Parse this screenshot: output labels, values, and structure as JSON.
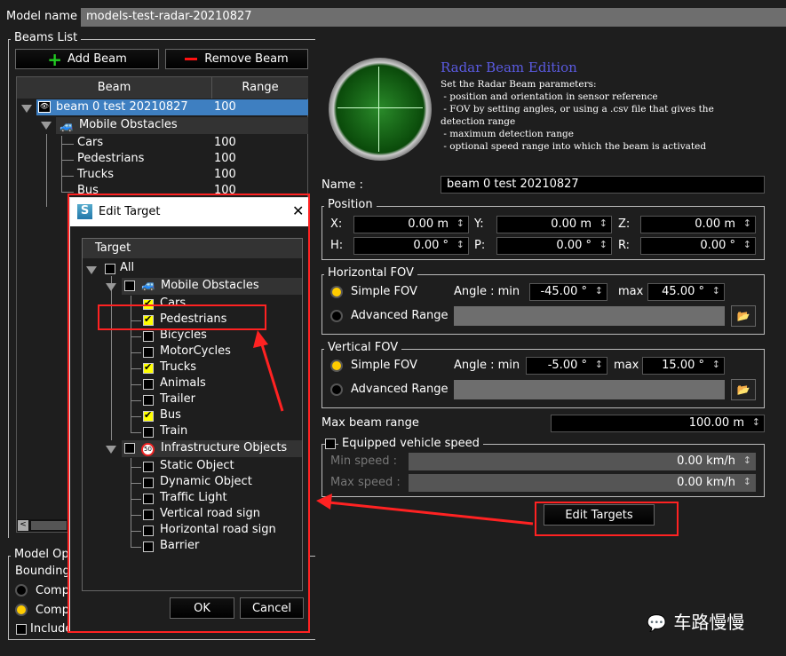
{
  "model_name": {
    "label": "Model name",
    "value": "models-test-radar-20210827"
  },
  "beams": {
    "title": "Beams List",
    "add": "Add Beam",
    "remove": "Remove Beam",
    "col_beam": "Beam",
    "col_range": "Range",
    "beam": {
      "name": "beam 0 test 20210827",
      "range": "100"
    },
    "group": "Mobile Obstacles",
    "items": [
      {
        "name": "Cars",
        "range": "100"
      },
      {
        "name": "Pedestrians",
        "range": "100"
      },
      {
        "name": "Trucks",
        "range": "100"
      },
      {
        "name": "Bus",
        "range": "100"
      }
    ]
  },
  "model_options": {
    "title": "Model Opt",
    "bounding": "Bounding",
    "opt1": "Comp",
    "opt2": "Comp",
    "include": "Include"
  },
  "info": {
    "title": "Radar Beam Edition",
    "lines": [
      "Set the Radar Beam parameters:",
      " - position and orientation in sensor reference",
      " - FOV by setting angles, or using a .csv file that gives the",
      "detection range",
      " - maximum detection range",
      " - optional speed range into which the beam is activated"
    ]
  },
  "name": {
    "label": "Name :",
    "value": "beam 0 test 20210827"
  },
  "position": {
    "title": "Position",
    "x": "0.00 m",
    "y": "0.00 m",
    "z": "0.00 m",
    "h": "0.00 °",
    "p": "0.00 °",
    "r": "0.00 °",
    "lx": "X:",
    "ly": "Y:",
    "lz": "Z:",
    "lh": "H:",
    "lp": "P:",
    "lr": "R:"
  },
  "hfov": {
    "title": "Horizontal FOV",
    "simple": "Simple FOV",
    "advanced": "Advanced Range",
    "angle_min": "Angle : min",
    "max": "max",
    "min_value": "-45.00 °",
    "max_value": "45.00 °"
  },
  "vfov": {
    "title": "Vertical FOV",
    "simple": "Simple FOV",
    "advanced": "Advanced Range",
    "angle_min": "Angle : min",
    "max": "max",
    "min_value": "-5.00 °",
    "max_value": "15.00 °"
  },
  "max_range": {
    "label": "Max beam range",
    "value": "100.00 m"
  },
  "speed": {
    "title": "Equipped vehicle speed",
    "min_label": "Min speed :",
    "min_value": "0.00 km/h",
    "max_label": "Max speed :",
    "max_value": "0.00 km/h"
  },
  "edit_targets": "Edit Targets",
  "dialog": {
    "title": "Edit Target",
    "header": "Target",
    "all": "All",
    "ok": "OK",
    "cancel": "Cancel",
    "mobile": "Mobile Obstacles",
    "infra": "Infrastructure Objects",
    "mobile_items": [
      {
        "name": "Cars",
        "checked": true
      },
      {
        "name": "Pedestrians",
        "checked": true
      },
      {
        "name": "Bicycles",
        "checked": false
      },
      {
        "name": "MotorCycles",
        "checked": false
      },
      {
        "name": "Trucks",
        "checked": true
      },
      {
        "name": "Animals",
        "checked": false
      },
      {
        "name": "Trailer",
        "checked": false
      },
      {
        "name": "Bus",
        "checked": true
      },
      {
        "name": "Train",
        "checked": false
      }
    ],
    "infra_items": [
      {
        "name": "Static Object",
        "checked": false
      },
      {
        "name": "Dynamic Object",
        "checked": false
      },
      {
        "name": "Traffic Light",
        "checked": false
      },
      {
        "name": "Vertical road sign",
        "checked": false
      },
      {
        "name": "Horizontal road sign",
        "checked": false
      },
      {
        "name": "Barrier",
        "checked": false
      }
    ]
  },
  "watermark": "车路慢慢",
  "colors": {
    "selection": "#3e7fc1",
    "title": "#5a5ae0",
    "radio_on": "#ffcc00",
    "annotation": "#ff2222"
  }
}
